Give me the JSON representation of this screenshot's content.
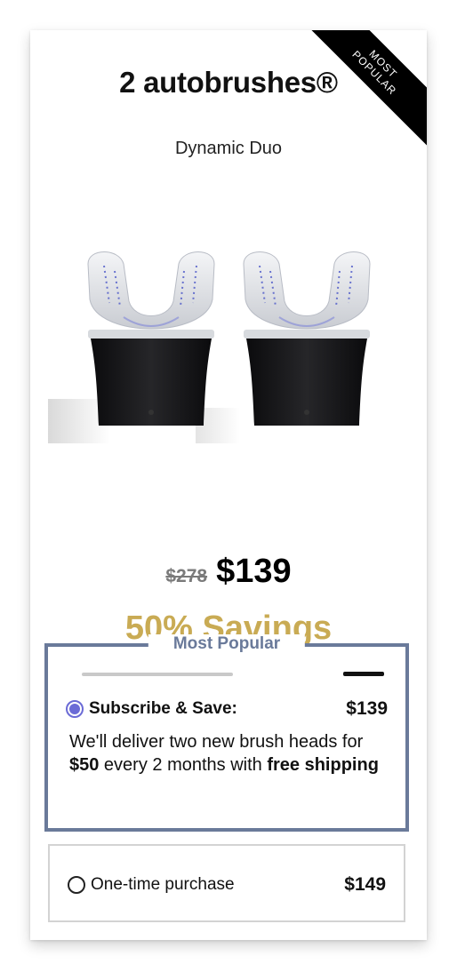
{
  "ribbon": {
    "line1": "MOST",
    "line2": "POPULAR"
  },
  "product": {
    "title": "2 autobrushes®",
    "subtitle": "Dynamic Duo",
    "image_alt": "two black autobrush toothbrush devices"
  },
  "pricing": {
    "old_price": "$278",
    "new_price": "$139",
    "savings": "50% Savings"
  },
  "popular_box": {
    "label": "Most Popular",
    "subscribe": {
      "label": "Subscribe & Save:",
      "price": "$139",
      "selected": true,
      "desc_prefix": "We'll deliver two new brush heads for ",
      "desc_amount": "$50",
      "desc_middle": " every 2 months with ",
      "desc_shipping": "free shipping"
    }
  },
  "one_time": {
    "label": "One-time purchase",
    "price": "$149",
    "selected": false
  },
  "colors": {
    "accent_gold": "#c9ab54",
    "box_border": "#6a7a9a",
    "radio_selected": "#6b6bd6"
  }
}
